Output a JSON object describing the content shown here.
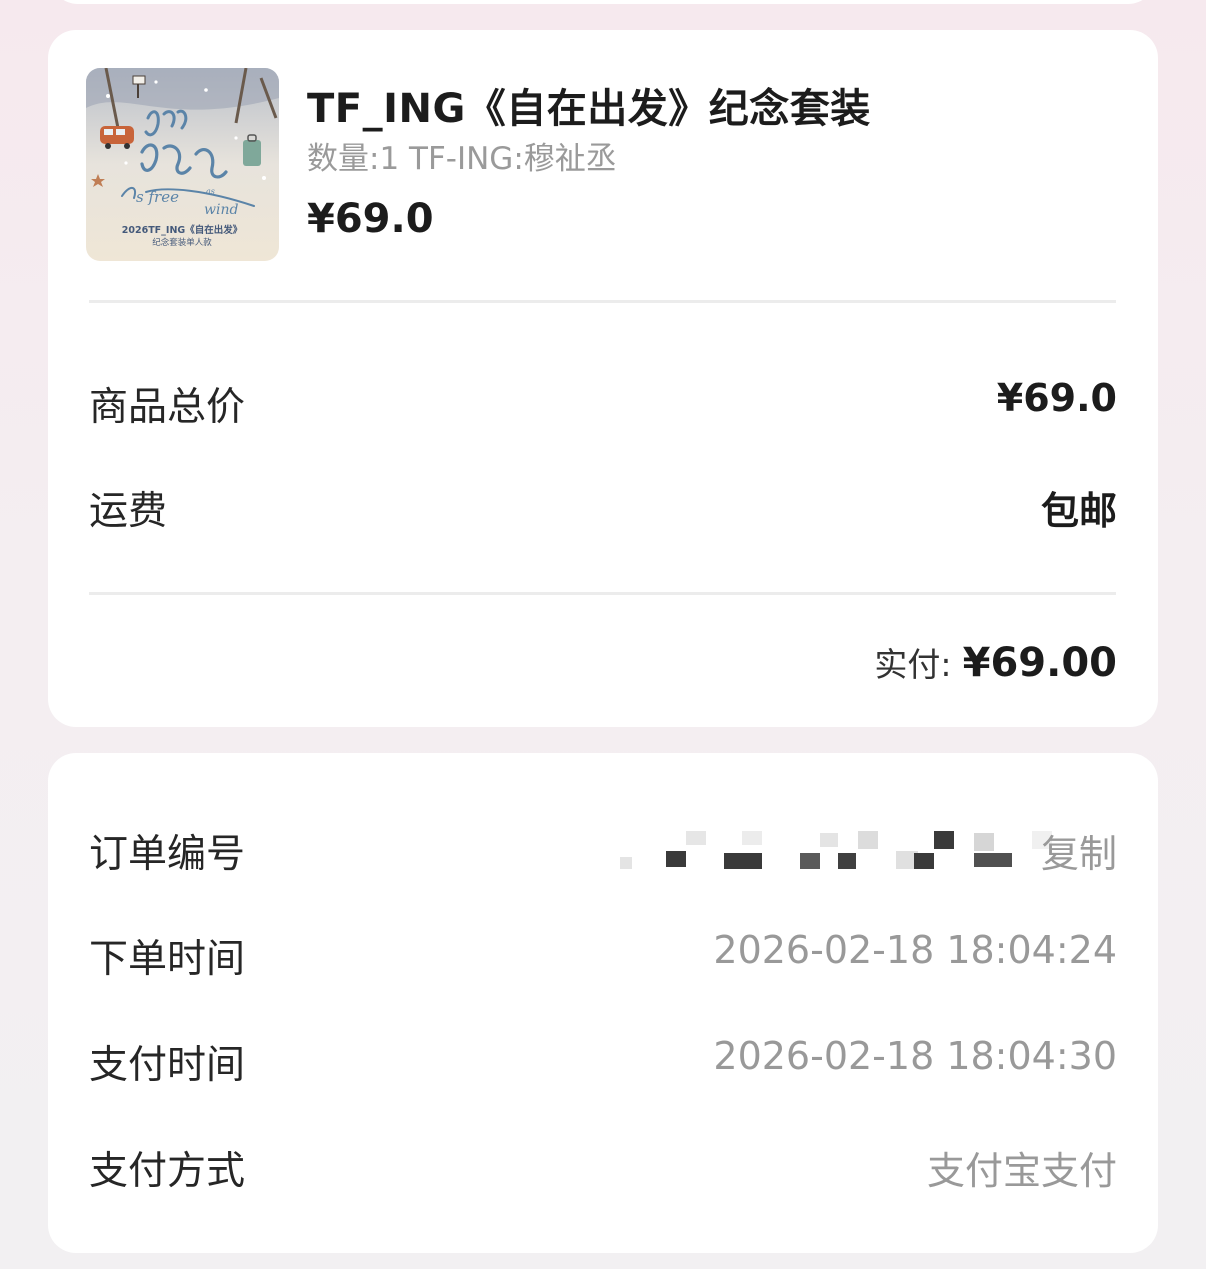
{
  "product": {
    "title": "TF_ING《自在出发》纪念套装",
    "spec": "数量:1 TF-ING:穆祉丞",
    "price": "¥69.0",
    "thumbnail": {
      "headline": "自在如风",
      "subtitle": "As free as wind",
      "caption_line1": "2026TF_ING《自在出发》",
      "caption_line2": "纪念套装单人款"
    }
  },
  "summary": {
    "goods_total_label": "商品总价",
    "goods_total_value": "¥69.0",
    "shipping_label": "运费",
    "shipping_value": "包邮",
    "paid_label": "实付:",
    "paid_value": "¥69.00"
  },
  "order_info": {
    "order_number_label": "订单编号",
    "copy_label": "复制",
    "order_time_label": "下单时间",
    "order_time_value": "2026-02-18 18:04:24",
    "pay_time_label": "支付时间",
    "pay_time_value": "2026-02-18 18:04:30",
    "pay_method_label": "支付方式",
    "pay_method_value": "支付宝支付"
  },
  "colors": {
    "page_background": "#f4edf0",
    "card_background": "#ffffff",
    "primary_text": "#1c1c1c",
    "muted_text": "#999999",
    "divider": "#ececec"
  }
}
